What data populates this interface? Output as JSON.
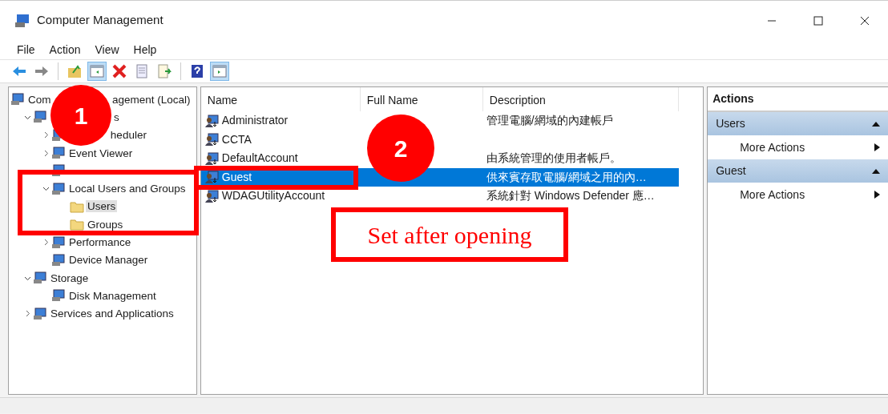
{
  "window": {
    "title": "Computer Management"
  },
  "menu": [
    "File",
    "Action",
    "View",
    "Help"
  ],
  "toolbar": [
    [
      {
        "kind": "back",
        "pressed": false
      },
      {
        "kind": "forward",
        "pressed": false
      }
    ],
    [
      {
        "kind": "up",
        "pressed": false
      },
      {
        "kind": "tree",
        "pressed": true
      },
      {
        "kind": "delete",
        "pressed": false
      },
      {
        "kind": "properties",
        "pressed": false
      },
      {
        "kind": "export",
        "pressed": false
      }
    ],
    [
      {
        "kind": "help",
        "pressed": false
      },
      {
        "kind": "pane",
        "pressed": true
      }
    ]
  ],
  "tree": [
    {
      "label_parts": [
        "Com",
        "agement (Local)"
      ],
      "selected": false,
      "children": [
        {
          "label_parts": [
            "s"
          ],
          "selected": false,
          "expanded": true,
          "children": [
            {
              "label_parts": [
                "heduler"
              ],
              "selected": false,
              "expanded": false
            },
            {
              "label": "Event Viewer",
              "selected": false,
              "expanded": false
            },
            {
              "selected": false
            },
            {
              "label": "Local Users and Groups",
              "selected": false,
              "expanded": true,
              "children": [
                {
                  "label": "Users",
                  "selected": true
                },
                {
                  "label": "Groups",
                  "selected": false
                }
              ]
            },
            {
              "label": "Performance",
              "selected": false,
              "expanded": false
            },
            {
              "label": "Device Manager",
              "selected": false
            }
          ]
        },
        {
          "label": "Storage",
          "selected": false,
          "expanded": true,
          "children": [
            {
              "label": "Disk Management",
              "selected": false
            }
          ]
        },
        {
          "label": "Services and Applications",
          "selected": false,
          "expanded": false
        }
      ]
    }
  ],
  "table": {
    "columns": [
      "Name",
      "Full Name",
      "Description"
    ],
    "rows": [
      {
        "name": "Administrator",
        "description": "管理電腦/網域的內建帳戶",
        "selected": false
      },
      {
        "name": "CCTA",
        "selected": false
      },
      {
        "name": "DefaultAccount",
        "description": "由系統管理的使用者帳戶。",
        "selected": false
      },
      {
        "name": "Guest",
        "description": "供來賓存取電腦/網域之用的內…",
        "selected": true
      },
      {
        "name": "WDAGUtilityAccount",
        "description": "系統針對 Windows Defender 應…",
        "selected": false
      }
    ]
  },
  "actions": {
    "title": "Actions",
    "sections": [
      {
        "title": "Users",
        "expanded": true,
        "items": [
          "More Actions"
        ]
      },
      {
        "title": "Guest",
        "expanded": true,
        "items": [
          "More Actions"
        ]
      }
    ]
  },
  "annotations": [
    {
      "kind": "circle",
      "label": "1"
    },
    {
      "kind": "box"
    },
    {
      "kind": "circle",
      "label": "2"
    },
    {
      "kind": "box"
    },
    {
      "kind": "box",
      "label": "Set after opening"
    }
  ]
}
